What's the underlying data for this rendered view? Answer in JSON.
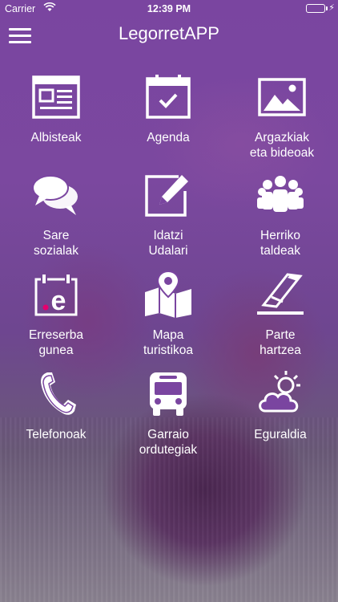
{
  "status": {
    "carrier": "Carrier",
    "time": "12:39 PM",
    "battery_level": 1.0
  },
  "header": {
    "title": "LegorretAPP",
    "menu_icon": "hamburger-menu-icon"
  },
  "tiles": [
    {
      "line1": "Albisteak",
      "line2": "",
      "icon": "newspaper-icon"
    },
    {
      "line1": "Agenda",
      "line2": "",
      "icon": "calendar-check-icon"
    },
    {
      "line1": "Argazkiak",
      "line2": "eta bideoak",
      "icon": "image-icon"
    },
    {
      "line1": "Sare",
      "line2": "sozialak",
      "icon": "chat-bubbles-icon"
    },
    {
      "line1": "Idatzi",
      "line2": "Udalari",
      "icon": "edit-icon"
    },
    {
      "line1": "Herriko",
      "line2": "taldeak",
      "icon": "group-icon"
    },
    {
      "line1": "Erreserba",
      "line2": "gunea",
      "icon": "e-calendar-icon"
    },
    {
      "line1": "Mapa",
      "line2": "turistikoa",
      "icon": "map-icon"
    },
    {
      "line1": "Parte",
      "line2": "hartzea",
      "icon": "ballot-icon"
    },
    {
      "line1": "Telefonoak",
      "line2": "",
      "icon": "phone-icon"
    },
    {
      "line1": "Garraio",
      "line2": "ordutegiak",
      "icon": "bus-icon"
    },
    {
      "line1": "Eguraldia",
      "line2": "",
      "icon": "weather-icon"
    }
  ],
  "colors": {
    "background": "#7a45a0",
    "text": "#ffffff",
    "accent_dot": "#e6006e"
  }
}
